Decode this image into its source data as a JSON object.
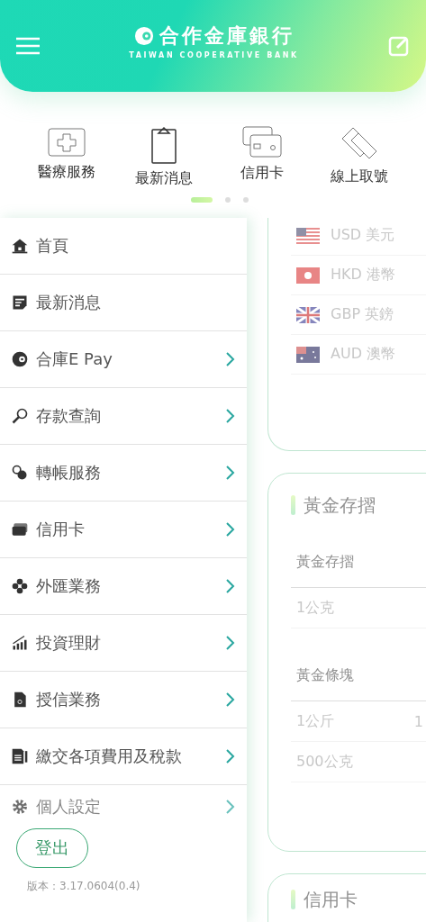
{
  "header": {
    "bank_name": "合作金庫銀行",
    "bank_name_en": "TAIWAN COOPERATIVE BANK"
  },
  "quick_links": [
    {
      "label": "醫療服務"
    },
    {
      "label": "最新消息"
    },
    {
      "label": "信用卡"
    },
    {
      "label": "線上取號"
    }
  ],
  "page_dots": [
    {
      "selected": true
    },
    {
      "selected": false
    },
    {
      "selected": false
    }
  ],
  "menu": {
    "items": [
      {
        "label": "首頁",
        "has_arrow": false
      },
      {
        "label": "最新消息",
        "has_arrow": false
      },
      {
        "label": "合庫E Pay",
        "has_arrow": true
      },
      {
        "label": "存款查詢",
        "has_arrow": true
      },
      {
        "label": "轉帳服務",
        "has_arrow": true
      },
      {
        "label": "信用卡",
        "has_arrow": true
      },
      {
        "label": "外匯業務",
        "has_arrow": true
      },
      {
        "label": "投資理財",
        "has_arrow": true
      },
      {
        "label": "授信業務",
        "has_arrow": true
      },
      {
        "label": "繳交各項費用及稅款",
        "has_arrow": true
      },
      {
        "label": "個人設定",
        "has_arrow": true
      }
    ],
    "logout": "登出",
    "version": "版本：3.17.0604(0.4)"
  },
  "content": {
    "currencies": [
      {
        "label": "USD 美元"
      },
      {
        "label": "HKD 港幣"
      },
      {
        "label": "GBP 英鎊"
      },
      {
        "label": "AUD 澳幣"
      }
    ],
    "gold_card": {
      "title": "黃金存摺",
      "sections": [
        {
          "heading": "黃金存摺",
          "rows": [
            {
              "column_1": "1公克"
            }
          ]
        },
        {
          "heading": "黃金條塊",
          "rows": [
            {
              "column_1": "1公斤",
              "column_2": "1"
            },
            {
              "column_1": "500公克"
            }
          ]
        }
      ]
    },
    "next_card": {
      "title": "信用卡"
    }
  }
}
